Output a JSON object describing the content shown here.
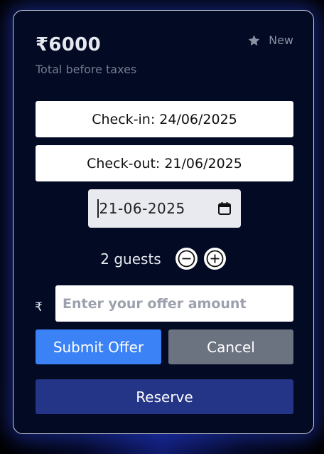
{
  "listing": {
    "price": "₹6000",
    "price_note": "Total before taxes",
    "badge_label": "New",
    "badge_icon": "star-icon"
  },
  "dates": {
    "checkin_text": "Check-in: 24/06/2025",
    "checkout_text": "Check-out: 21/06/2025",
    "date_value": "21-06-2025",
    "date_icon": "calendar-icon"
  },
  "guests": {
    "label": "2 guests",
    "decrement_icon": "minus-icon",
    "increment_icon": "plus-icon"
  },
  "offer": {
    "currency_symbol": "₹",
    "placeholder": "Enter your offer amount",
    "submit_label": "Submit Offer",
    "cancel_label": "Cancel"
  },
  "reserve": {
    "label": "Reserve"
  },
  "colors": {
    "card_bg": "#020a24",
    "submit": "#3b82f6",
    "cancel": "#6b7280",
    "reserve": "#243487"
  }
}
